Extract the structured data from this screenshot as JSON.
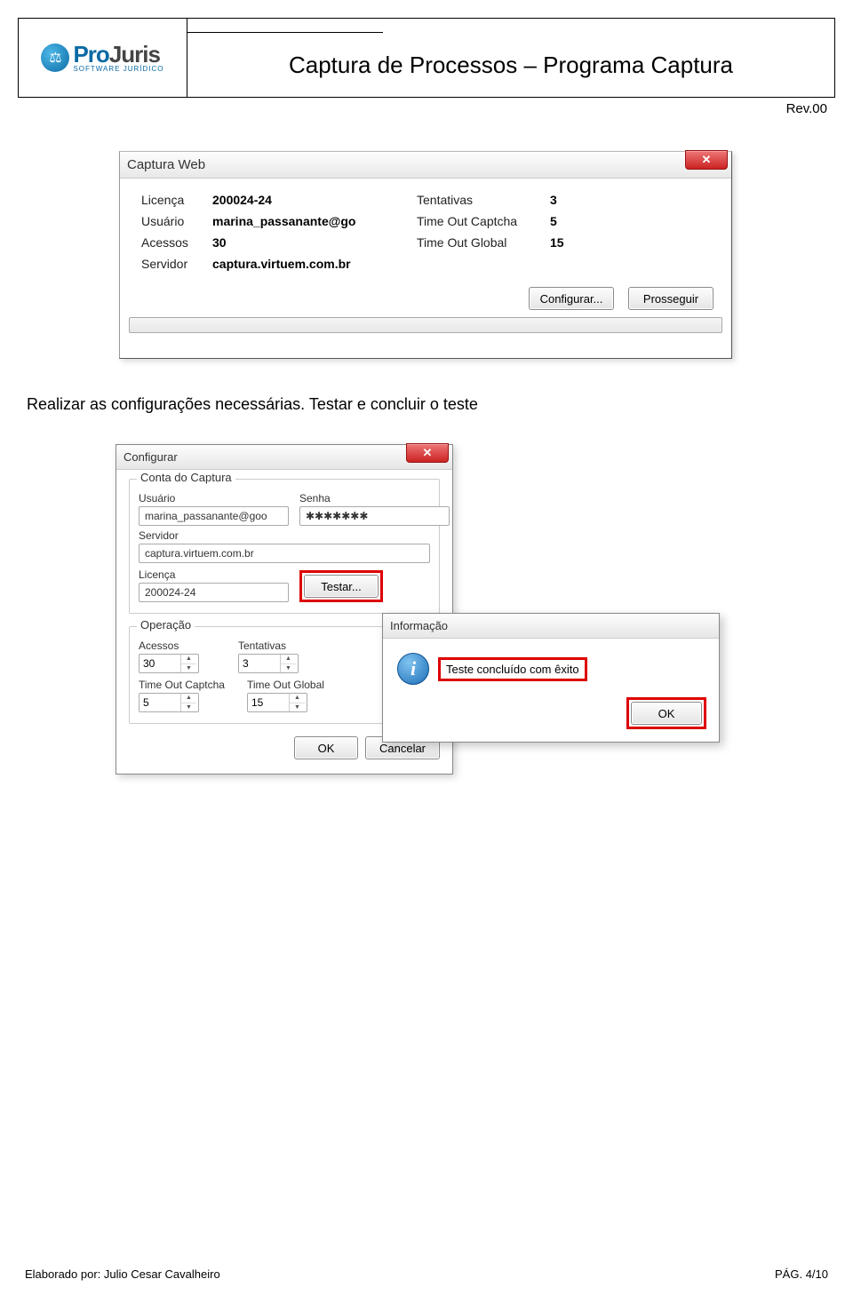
{
  "header": {
    "logo_main_a": "Pro",
    "logo_main_b": "Juris",
    "logo_sub": "SOFTWARE  JURÍDICO",
    "title": "Captura de Processos – Programa Captura",
    "rev": "Rev.00"
  },
  "dialog1": {
    "title": "Captura Web",
    "labels": {
      "licenca": "Licença",
      "usuario": "Usuário",
      "acessos": "Acessos",
      "servidor": "Servidor",
      "tentativas": "Tentativas",
      "timeout_captcha": "Time Out Captcha",
      "timeout_global": "Time Out Global"
    },
    "values": {
      "licenca": "200024-24",
      "usuario": "marina_passanante@go",
      "acessos": "30",
      "servidor": "captura.virtuem.com.br",
      "tentativas": "3",
      "timeout_captcha": "5",
      "timeout_global": "15"
    },
    "buttons": {
      "configurar": "Configurar...",
      "prosseguir": "Prosseguir"
    }
  },
  "paragraph": "Realizar as configurações necessárias. Testar e concluir o teste",
  "dialog2": {
    "title": "Configurar",
    "group_conta": "Conta do Captura",
    "group_operacao": "Operação",
    "labels": {
      "usuario": "Usuário",
      "senha": "Senha",
      "servidor": "Servidor",
      "licenca": "Licença",
      "acessos": "Acessos",
      "tentativas": "Tentativas",
      "timeout_captcha": "Time Out Captcha",
      "timeout_global": "Time Out Global"
    },
    "values": {
      "usuario": "marina_passanante@goo",
      "senha": "✱✱✱✱✱✱✱",
      "servidor": "captura.virtuem.com.br",
      "licenca": "200024-24",
      "acessos": "30",
      "tentativas": "3",
      "timeout_captcha": "5",
      "timeout_global": "15"
    },
    "buttons": {
      "testar": "Testar...",
      "ok": "OK",
      "cancelar": "Cancelar"
    }
  },
  "dialog3": {
    "title": "Informação",
    "message": "Teste concluído com êxito",
    "ok": "OK"
  },
  "footer": {
    "author_prefix": "Elaborado por: ",
    "author": "Julio Cesar Cavalheiro",
    "page": "PÁG. 4/10"
  }
}
